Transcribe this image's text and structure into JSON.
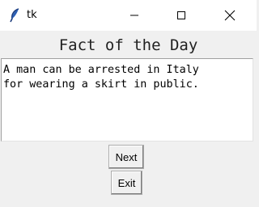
{
  "window": {
    "title": "tk",
    "controls": {
      "minimize_icon": "minimize-icon",
      "maximize_icon": "maximize-icon",
      "close_icon": "close-icon"
    }
  },
  "heading": "Fact of the Day",
  "fact_text": "A man can be arrested in Italy\nfor wearing a skirt in public.",
  "buttons": {
    "next": "Next",
    "exit": "Exit"
  }
}
